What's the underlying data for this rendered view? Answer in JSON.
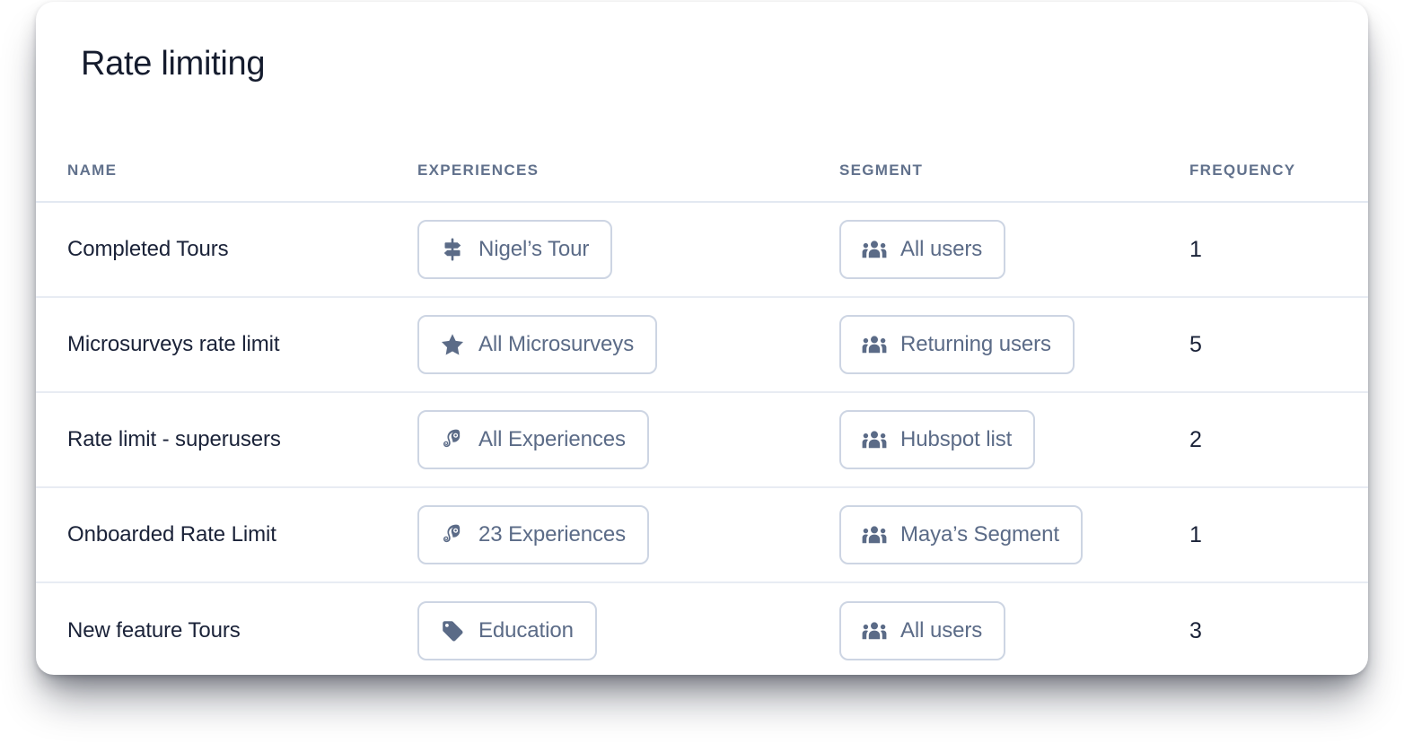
{
  "card": {
    "title": "Rate limiting"
  },
  "table": {
    "headers": {
      "name": "NAME",
      "experiences": "EXPERIENCES",
      "segment": "SEGMENT",
      "frequency": "FREQUENCY"
    },
    "rows": [
      {
        "name": "Completed Tours",
        "experience": {
          "label": "Nigel’s Tour",
          "icon": "signpost-icon"
        },
        "segment": {
          "label": "All users",
          "icon": "users-group-icon"
        },
        "frequency": "1"
      },
      {
        "name": "Microsurveys rate limit",
        "experience": {
          "label": "All Microsurveys",
          "icon": "star-icon"
        },
        "segment": {
          "label": "Returning users",
          "icon": "users-group-icon"
        },
        "frequency": "5"
      },
      {
        "name": "Rate limit - superusers",
        "experience": {
          "label": "All Experiences",
          "icon": "chameleon-icon"
        },
        "segment": {
          "label": "Hubspot list",
          "icon": "users-group-icon"
        },
        "frequency": "2"
      },
      {
        "name": "Onboarded Rate Limit",
        "experience": {
          "label": "23 Experiences",
          "icon": "chameleon-icon"
        },
        "segment": {
          "label": "Maya’s Segment",
          "icon": "users-group-icon"
        },
        "frequency": "1"
      },
      {
        "name": "New feature Tours",
        "experience": {
          "label": "Education",
          "icon": "tag-icon"
        },
        "segment": {
          "label": "All users",
          "icon": "users-group-icon"
        },
        "frequency": "3"
      }
    ]
  },
  "colors": {
    "title_text": "#151c2e",
    "header_text": "#61718c",
    "body_text": "#1a2238",
    "pill_text": "#5b6b87",
    "pill_border": "#cdd5e3",
    "divider": "#e8ecf3",
    "card_bg": "#ffffff"
  }
}
